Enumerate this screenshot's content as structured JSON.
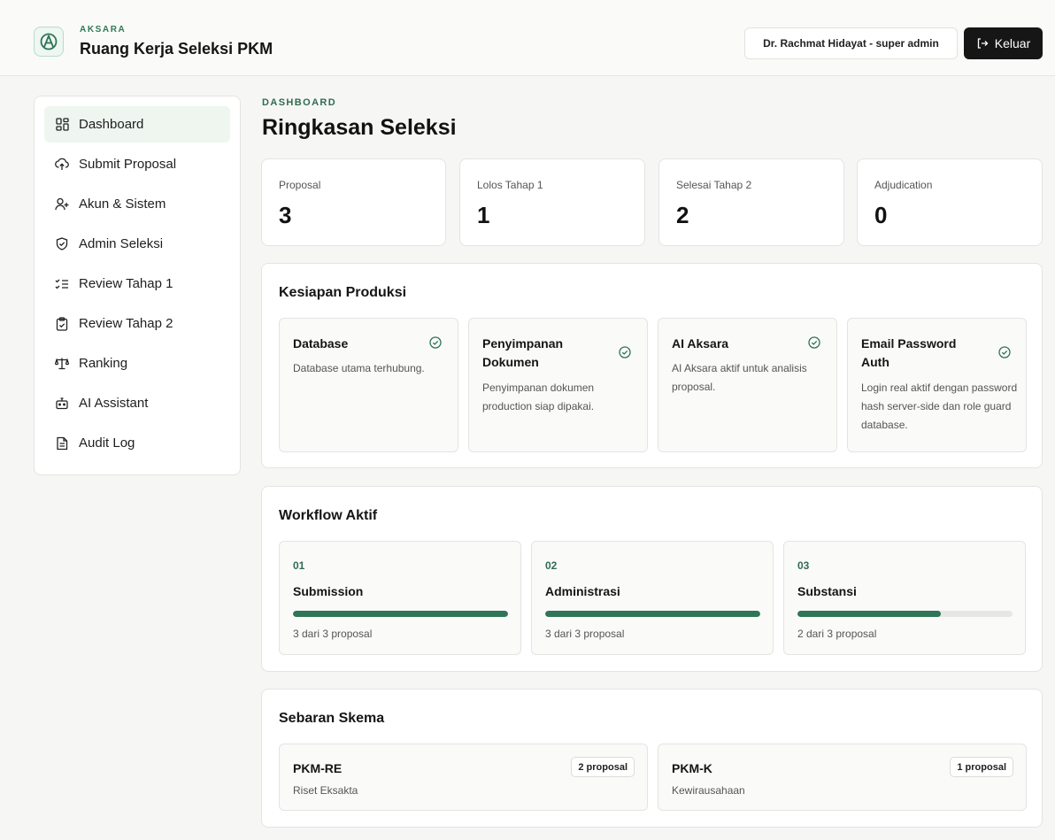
{
  "header": {
    "kicker": "AKSARA",
    "title": "Ruang Kerja Seleksi PKM",
    "user": "Dr. Rachmat Hidayat - super admin",
    "logout_label": "Keluar"
  },
  "sidebar": {
    "items": [
      {
        "label": "Dashboard",
        "icon": "layout-grid-icon",
        "active": true
      },
      {
        "label": "Submit Proposal",
        "icon": "cloud-upload-icon",
        "active": false
      },
      {
        "label": "Akun & Sistem",
        "icon": "user-plus-icon",
        "active": false
      },
      {
        "label": "Admin Seleksi",
        "icon": "shield-check-icon",
        "active": false
      },
      {
        "label": "Review Tahap 1",
        "icon": "list-check-icon",
        "active": false
      },
      {
        "label": "Review Tahap 2",
        "icon": "clipboard-check-icon",
        "active": false
      },
      {
        "label": "Ranking",
        "icon": "scale-icon",
        "active": false
      },
      {
        "label": "AI Assistant",
        "icon": "bot-icon",
        "active": false
      },
      {
        "label": "Audit Log",
        "icon": "file-text-icon",
        "active": false
      }
    ]
  },
  "main": {
    "kicker": "DASHBOARD",
    "title": "Ringkasan Seleksi",
    "stats": [
      {
        "label": "Proposal",
        "value": "3"
      },
      {
        "label": "Lolos Tahap 1",
        "value": "1"
      },
      {
        "label": "Selesai Tahap 2",
        "value": "2"
      },
      {
        "label": "Adjudication",
        "value": "0"
      }
    ],
    "readiness": {
      "title": "Kesiapan Produksi",
      "items": [
        {
          "title": "Database",
          "desc": "Database utama terhubung."
        },
        {
          "title": "Penyimpanan Dokumen",
          "desc": "Penyimpanan dokumen production siap dipakai."
        },
        {
          "title": "AI Aksara",
          "desc": "AI Aksara aktif untuk analisis proposal."
        },
        {
          "title": "Email Password Auth",
          "desc": "Login real aktif dengan password hash server-side dan role guard database."
        }
      ]
    },
    "workflow": {
      "title": "Workflow Aktif",
      "steps": [
        {
          "num": "01",
          "name": "Submission",
          "count": "3 dari 3 proposal",
          "progress": 1.0
        },
        {
          "num": "02",
          "name": "Administrasi",
          "count": "3 dari 3 proposal",
          "progress": 1.0
        },
        {
          "num": "03",
          "name": "Substansi",
          "count": "2 dari 3 proposal",
          "progress": 0.667
        }
      ]
    },
    "schemes": {
      "title": "Sebaran Skema",
      "items": [
        {
          "name": "PKM-RE",
          "desc": "Riset Eksakta",
          "badge": "2 proposal"
        },
        {
          "name": "PKM-K",
          "desc": "Kewirausahaan",
          "badge": "1 proposal"
        }
      ]
    }
  },
  "colors": {
    "accent": "#2f7556",
    "active_nav_bg": "#eef6ef",
    "logout_bg": "#161616"
  }
}
